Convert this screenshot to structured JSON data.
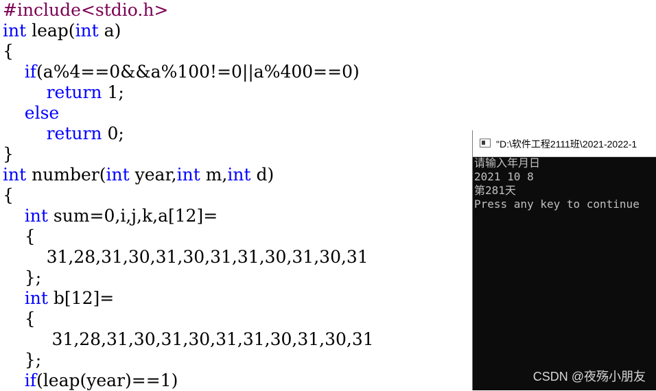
{
  "editor": {
    "lines": [
      [
        {
          "t": "pre",
          "s": "#include<stdio.h>"
        }
      ],
      [
        {
          "t": "kw",
          "s": "int"
        },
        {
          "t": "plain",
          "s": " leap("
        },
        {
          "t": "kw",
          "s": "int"
        },
        {
          "t": "plain",
          "s": " a)"
        }
      ],
      [
        {
          "t": "plain",
          "s": "{"
        }
      ],
      [
        {
          "t": "plain",
          "s": "    "
        },
        {
          "t": "kw",
          "s": "if"
        },
        {
          "t": "plain",
          "s": "(a%4==0&&a%100!=0||a%400==0)"
        }
      ],
      [
        {
          "t": "plain",
          "s": "        "
        },
        {
          "t": "kw",
          "s": "return"
        },
        {
          "t": "plain",
          "s": " 1;"
        }
      ],
      [
        {
          "t": "plain",
          "s": "    "
        },
        {
          "t": "kw",
          "s": "else"
        }
      ],
      [
        {
          "t": "plain",
          "s": "        "
        },
        {
          "t": "kw",
          "s": "return"
        },
        {
          "t": "plain",
          "s": " 0;"
        }
      ],
      [
        {
          "t": "plain",
          "s": "}"
        }
      ],
      [
        {
          "t": "kw",
          "s": "int"
        },
        {
          "t": "plain",
          "s": " number("
        },
        {
          "t": "kw",
          "s": "int"
        },
        {
          "t": "plain",
          "s": " year,"
        },
        {
          "t": "kw",
          "s": "int"
        },
        {
          "t": "plain",
          "s": " m,"
        },
        {
          "t": "kw",
          "s": "int"
        },
        {
          "t": "plain",
          "s": " d)"
        }
      ],
      [
        {
          "t": "plain",
          "s": "{"
        }
      ],
      [
        {
          "t": "plain",
          "s": "    "
        },
        {
          "t": "kw",
          "s": "int"
        },
        {
          "t": "plain",
          "s": " sum=0,i,j,k,a[12]="
        }
      ],
      [
        {
          "t": "plain",
          "s": "    {"
        }
      ],
      [
        {
          "t": "plain",
          "s": "        31,28,31,30,31,30,31,31,30,31,30,31"
        }
      ],
      [
        {
          "t": "plain",
          "s": "    };"
        }
      ],
      [
        {
          "t": "plain",
          "s": "    "
        },
        {
          "t": "kw",
          "s": "int"
        },
        {
          "t": "plain",
          "s": " b[12]="
        }
      ],
      [
        {
          "t": "plain",
          "s": "    {"
        }
      ],
      [
        {
          "t": "plain",
          "s": "         31,28,31,30,31,30,31,31,30,31,30,31"
        }
      ],
      [
        {
          "t": "plain",
          "s": "    };"
        }
      ],
      [
        {
          "t": "plain",
          "s": "    "
        },
        {
          "t": "kw",
          "s": "if"
        },
        {
          "t": "plain",
          "s": "(leap(year)==1)"
        }
      ]
    ]
  },
  "console": {
    "title": "\"D:\\软件工程2111班\\2021-2022-1",
    "output": [
      "请输入年月日",
      "2021 10 8",
      "第281天",
      "Press any key to continue"
    ]
  },
  "watermark": "CSDN @夜殇小朋友"
}
